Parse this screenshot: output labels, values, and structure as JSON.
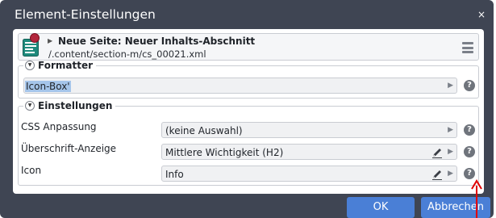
{
  "window": {
    "title": "Element-Einstellungen",
    "close_glyph": "×"
  },
  "resource": {
    "icon": "content-page-icon",
    "title": "Neue Seite: Neuer Inhalts-Abschnitt",
    "path": "/.content/section-m/cs_00021.xml",
    "menu_icon": "hamburger-menu-icon"
  },
  "formatter": {
    "legend": "Formatter",
    "value": "Icon-Box'"
  },
  "settings": {
    "legend": "Einstellungen",
    "rows": [
      {
        "label": "CSS Anpassung",
        "value": "(keine Auswahl)",
        "editable": false
      },
      {
        "label": "Überschrift-Anzeige",
        "value": "Mittlere Wichtigkeit (H2)",
        "editable": true
      },
      {
        "label": "Icon",
        "value": "Info",
        "editable": true
      }
    ]
  },
  "buttons": {
    "ok": "OK",
    "cancel": "Abbrechen"
  },
  "help_glyph": "?",
  "colors": {
    "dialog_bg": "#3f4553",
    "primary_button": "#4a7fd6",
    "selection": "#a5c5ea",
    "annotation_arrow": "#e00000"
  }
}
